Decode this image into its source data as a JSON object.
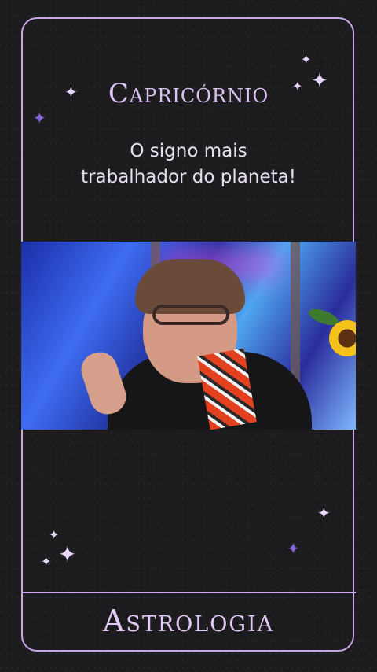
{
  "header": {
    "title": "Capricórnio",
    "subtitle": "O signo mais\ntrabalhador do planeta!"
  },
  "footer": {
    "label": "Astrologia"
  },
  "colors": {
    "accent": "#c9a6e8",
    "background": "#1c1c1f",
    "star_dark": "#8b64e0"
  }
}
